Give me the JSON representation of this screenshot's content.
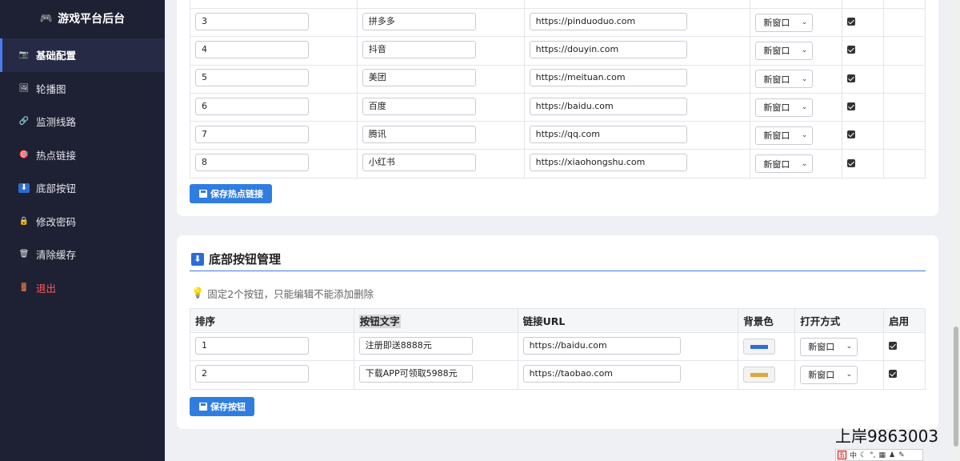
{
  "sidebar": {
    "brand": "游戏平台后台",
    "brand_icon": "🎮",
    "items": [
      {
        "label": "基础配置",
        "icon": "📷",
        "active": true
      },
      {
        "label": "轮播图",
        "icon": "🖼"
      },
      {
        "label": "监测线路",
        "icon": "🔗"
      },
      {
        "label": "热点链接",
        "icon": "🎯"
      },
      {
        "label": "底部按钮",
        "icon": "⬇"
      },
      {
        "label": "修改密码",
        "icon": "🔒"
      },
      {
        "label": "清除缓存",
        "icon": "🗑"
      },
      {
        "label": "退出",
        "icon": "🚪",
        "danger": true
      }
    ]
  },
  "hot_links": {
    "rows": [
      {
        "order": "3",
        "name": "拼多多",
        "url": "https://pinduoduo.com",
        "open": "新窗口",
        "enabled": true
      },
      {
        "order": "4",
        "name": "抖音",
        "url": "https://douyin.com",
        "open": "新窗口",
        "enabled": true
      },
      {
        "order": "5",
        "name": "美团",
        "url": "https://meituan.com",
        "open": "新窗口",
        "enabled": true
      },
      {
        "order": "6",
        "name": "百度",
        "url": "https://baidu.com",
        "open": "新窗口",
        "enabled": true
      },
      {
        "order": "7",
        "name": "腾讯",
        "url": "https://qq.com",
        "open": "新窗口",
        "enabled": true
      },
      {
        "order": "8",
        "name": "小红书",
        "url": "https://xiaohongshu.com",
        "open": "新窗口",
        "enabled": true
      }
    ],
    "save_label": "保存热点链接"
  },
  "bottom_buttons": {
    "title": "底部按钮管理",
    "title_icon": "⬇",
    "hint": "固定2个按钮，只能编辑不能添加删除",
    "headers": {
      "order": "排序",
      "text": "按钮文字",
      "url": "链接URL",
      "bg": "背景色",
      "open": "打开方式",
      "enabled": "启用"
    },
    "rows": [
      {
        "order": "1",
        "text": "注册即送8888元",
        "url": "https://baidu.com",
        "color": "#2f6fd6",
        "open": "新窗口",
        "enabled": true
      },
      {
        "order": "2",
        "text": "下载APP可领取5988元",
        "url": "https://taobao.com",
        "color": "#e0a83a",
        "open": "新窗口",
        "enabled": true
      }
    ],
    "save_label": "保存按钮"
  },
  "overlay": {
    "watermark": "上岸9863003",
    "ime_box": "五",
    "ime_mode": "中"
  }
}
